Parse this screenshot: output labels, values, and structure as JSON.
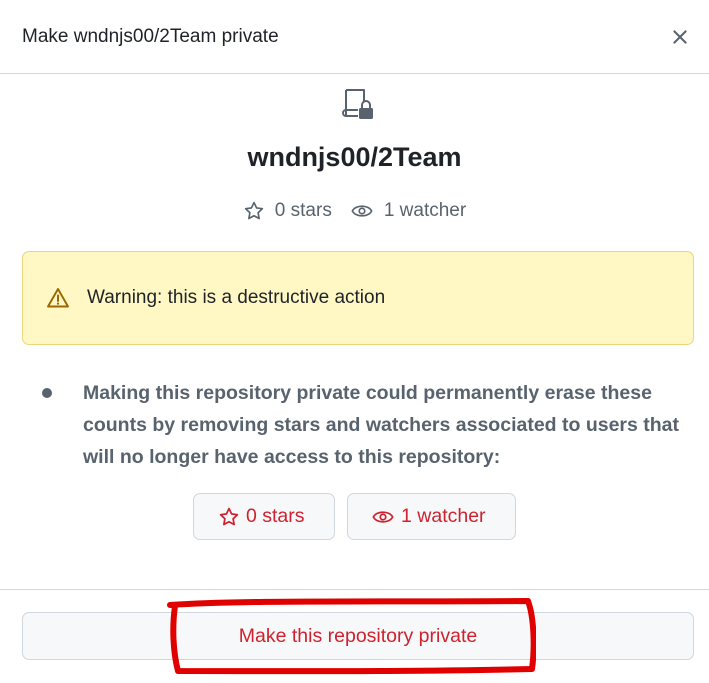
{
  "dialog": {
    "title": "Make wndnjs00/2Team private",
    "close_icon": "close-icon"
  },
  "repo": {
    "icon": "repo-locked-icon",
    "name": "wndnjs00/2Team",
    "stars_label": "0 stars",
    "watchers_label": "1 watcher"
  },
  "warning": {
    "icon": "alert-icon",
    "text": "Warning: this is a destructive action"
  },
  "description": "Making this repository private could permanently erase these counts by removing stars and watchers associated to users that will no longer have access to this repository:",
  "count_buttons": {
    "stars_label": "0 stars",
    "watchers_label": "1 watcher"
  },
  "confirm_button": {
    "label": "Make this repository private"
  },
  "colors": {
    "danger": "#cf222e",
    "warning_bg": "#fff8c5",
    "warning_border": "#e8d77b",
    "annotation": "#e00000"
  }
}
